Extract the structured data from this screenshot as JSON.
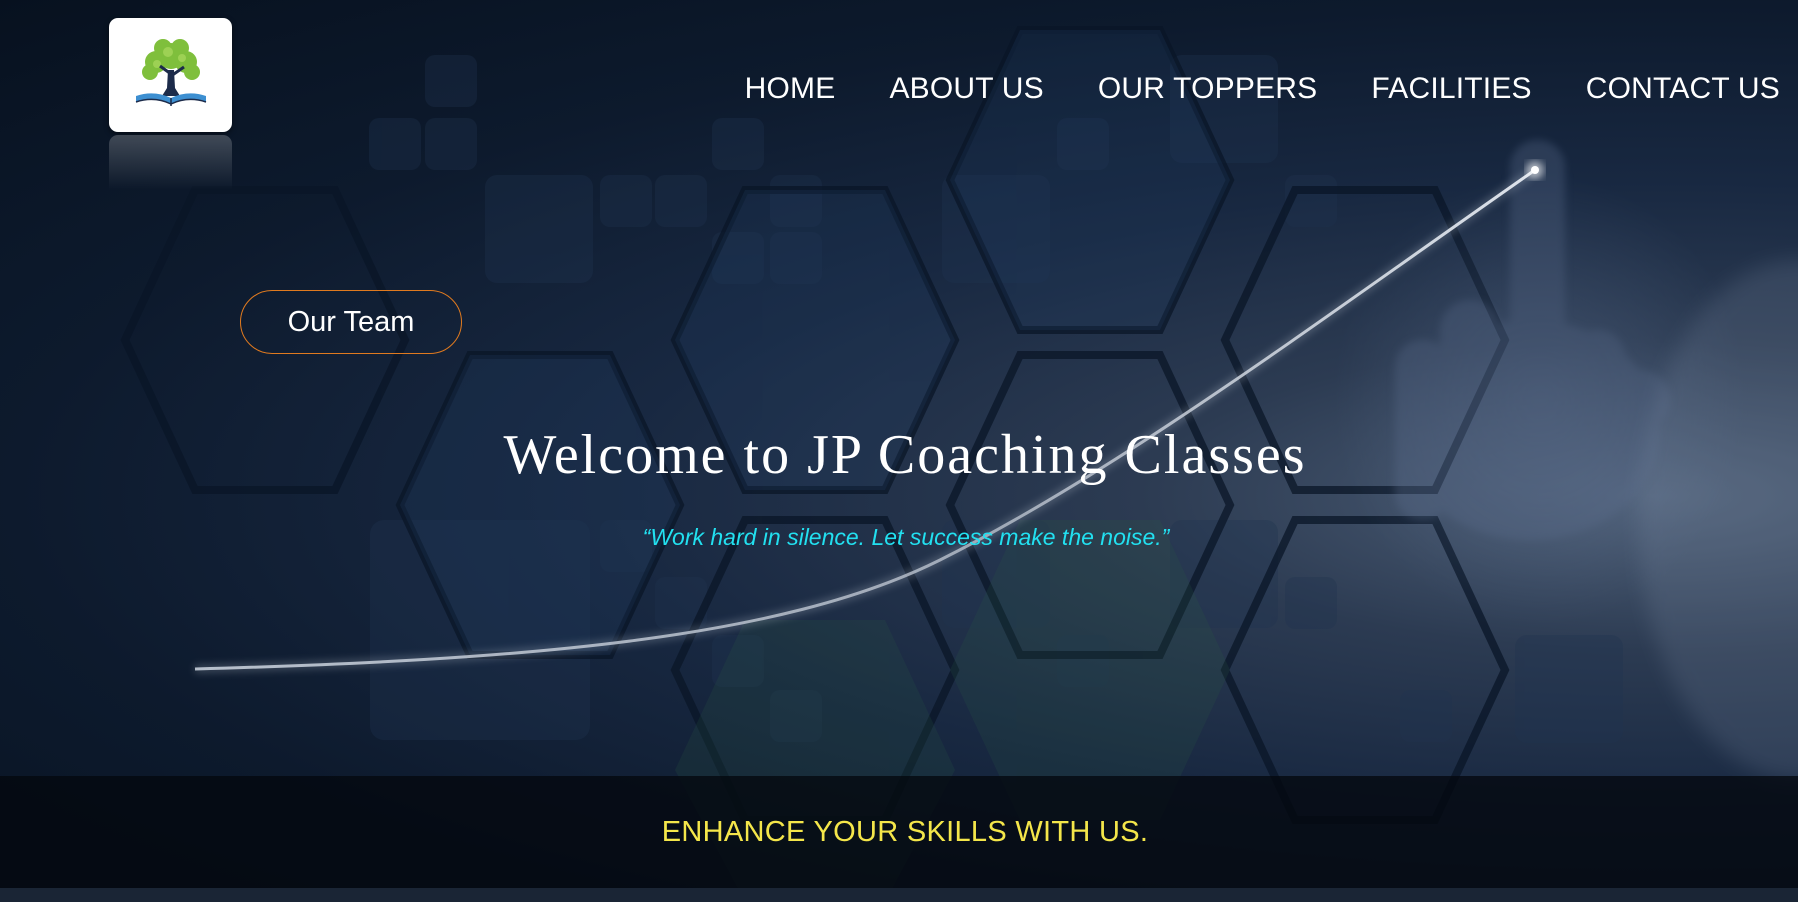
{
  "nav": {
    "items": [
      {
        "label": "HOME"
      },
      {
        "label": "ABOUT US"
      },
      {
        "label": "OUR TOPPERS"
      },
      {
        "label": "FACILITIES"
      },
      {
        "label": "CONTACT US"
      }
    ]
  },
  "hero": {
    "team_button_label": "Our Team",
    "title": "Welcome to JP Coaching Classes",
    "quote": "“Work hard in silence. Let success make the noise.”"
  },
  "band": {
    "text": "ENHANCE YOUR SKILLS WITH US."
  },
  "colors": {
    "nav_text": "#ffffff",
    "button_border": "#e07a1f",
    "quote": "#22e0f0",
    "band_text": "#f4e64a",
    "background": "#0d1a2d"
  },
  "icons": {
    "logo": "tree-book-logo-icon",
    "background": "hexagon-growth-curve-hand"
  }
}
